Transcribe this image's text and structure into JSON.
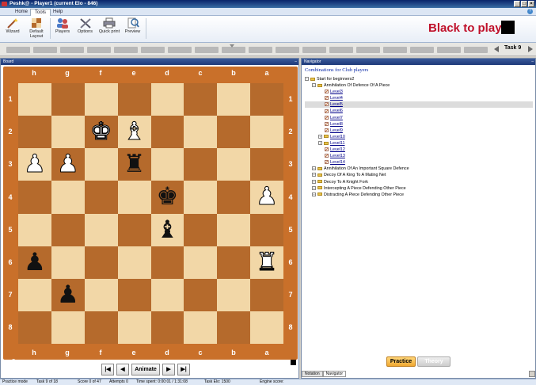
{
  "window": {
    "title": "Peshk@ - Player1 (current Elo - 846)"
  },
  "menu": {
    "tabs": [
      "Home",
      "Tools",
      "Help"
    ]
  },
  "ribbon": {
    "buttons": [
      "Wizard",
      "Default Layout",
      "Players",
      "Options",
      "Quick print",
      "Preview"
    ]
  },
  "banner": {
    "text": "Black to play"
  },
  "task": {
    "label": "Task 9"
  },
  "board": {
    "pane_title": "Board",
    "files": [
      "h",
      "g",
      "f",
      "e",
      "d",
      "c",
      "b",
      "a"
    ],
    "ranks": [
      "1",
      "2",
      "3",
      "4",
      "5",
      "6",
      "7",
      "8"
    ]
  },
  "nav_buttons": {
    "first": "|◀",
    "prev": "◀",
    "animate": "Animate",
    "next": "▶",
    "last": "▶|"
  },
  "navigator": {
    "pane_title": "Navigator",
    "heading": "Combinations for Club players",
    "tree": [
      {
        "label": "Start for beginners2"
      },
      {
        "label": "Annihilation Of Defence Of A Piece"
      },
      {
        "label": "Level3"
      },
      {
        "label": "Level4"
      },
      {
        "label": "Level5"
      },
      {
        "label": "Level6"
      },
      {
        "label": "Level7"
      },
      {
        "label": "Level8"
      },
      {
        "label": "Level9"
      },
      {
        "label": "Level10"
      },
      {
        "label": "Level11"
      },
      {
        "label": "Level12"
      },
      {
        "label": "Level13"
      },
      {
        "label": "Level14"
      },
      {
        "label": "Annihilation Of An Important Square Defence"
      },
      {
        "label": "Decoy Of A King To A Mating Net"
      },
      {
        "label": "Decoy To A Knight Fork"
      },
      {
        "label": "Intercepting A Piece Defending Other Piece"
      },
      {
        "label": "Distracting A Piece Defending Other Piece"
      }
    ],
    "practice": "Practice",
    "theory": "Theory",
    "bottom_tabs": [
      "Notation",
      "Navigator"
    ]
  },
  "status": {
    "mode": "Practice mode",
    "task": "Task 9 of 18",
    "score": "Score 0 of 47",
    "attempts": "Attempts 0",
    "time": "Time spent: 0:00:01 / 1:31:08",
    "task_elo": "Task Elo: 1500",
    "engine": "Engine score:"
  }
}
